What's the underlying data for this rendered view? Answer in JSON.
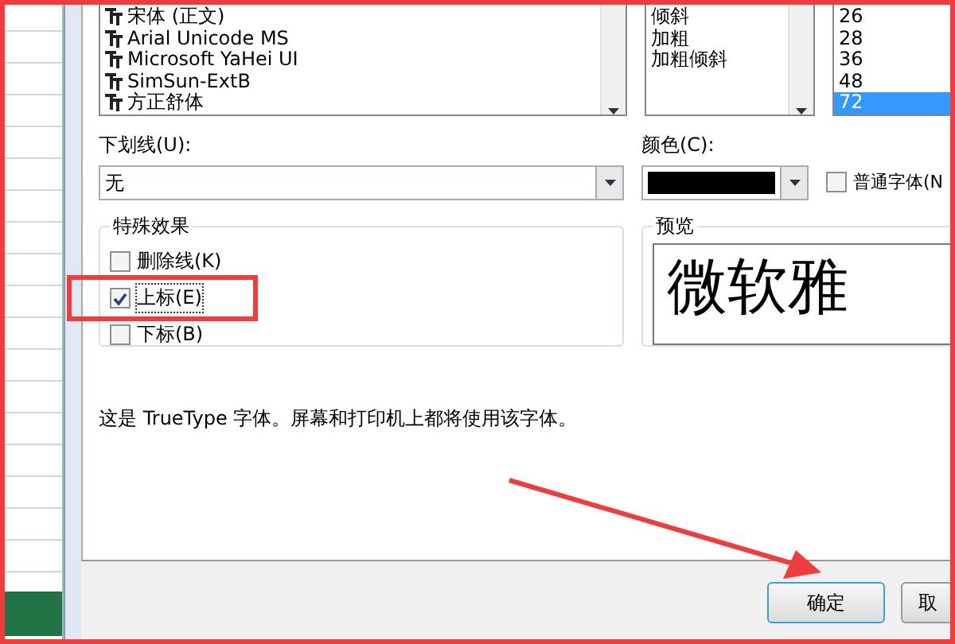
{
  "font_list": {
    "items": [
      {
        "label": "宋体 (正文)",
        "selected": false
      },
      {
        "label": "Arial Unicode MS",
        "selected": false
      },
      {
        "label": "Microsoft YaHei UI",
        "selected": false
      },
      {
        "label": "SimSun-ExtB",
        "selected": false
      },
      {
        "label": "方正舒体",
        "selected": false
      }
    ]
  },
  "style_list": {
    "items": [
      {
        "label": "倾斜",
        "selected": false
      },
      {
        "label": "加粗",
        "selected": false
      },
      {
        "label": "加粗倾斜",
        "selected": false
      }
    ]
  },
  "size_list": {
    "items": [
      {
        "label": "26",
        "selected": false
      },
      {
        "label": "28",
        "selected": false
      },
      {
        "label": "36",
        "selected": false
      },
      {
        "label": "48",
        "selected": false
      },
      {
        "label": "72",
        "selected": true
      }
    ]
  },
  "underline": {
    "label": "下划线(U):",
    "value": "无"
  },
  "color": {
    "label": "颜色(C):",
    "color": "#000000"
  },
  "normal_font": {
    "label": "普通字体(N",
    "checked": false
  },
  "effects": {
    "title": "特殊效果",
    "options": [
      {
        "label": "删除线(K)",
        "checked": false
      },
      {
        "label": "上标(E)",
        "checked": true
      },
      {
        "label": "下标(B)",
        "checked": false
      }
    ]
  },
  "preview": {
    "title": "预览",
    "sample": "微软雅"
  },
  "note": "这是 TrueType 字体。屏幕和打印机上都将使用该字体。",
  "buttons": [
    "确定",
    "取"
  ]
}
